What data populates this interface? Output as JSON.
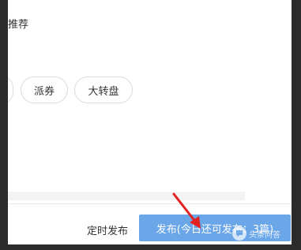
{
  "content": {
    "recommend_label": "推荐",
    "tags": [
      {
        "label": ""
      },
      {
        "label": "派券"
      },
      {
        "label": "大转盘"
      }
    ]
  },
  "footer": {
    "schedule_label": "定时发布",
    "publish_label": "发布(今日还可发布：3篇)",
    "publish_color": "#6aa6e8"
  },
  "watermark": {
    "logo_icon": "speech-bubble-icon",
    "text": "头条问答"
  },
  "annotation": {
    "arrow_color": "#e32222"
  }
}
